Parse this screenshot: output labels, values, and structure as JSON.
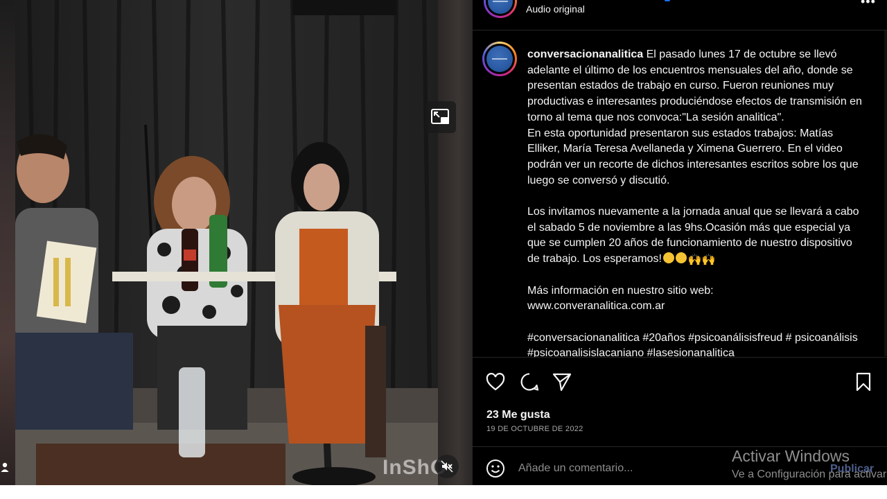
{
  "header": {
    "audio_label": "Audio original",
    "more_icon": "more-dots-icon"
  },
  "post": {
    "username": "conversacionanalitica",
    "caption_lines": [
      " El pasado lunes 17 de octubre se llevó adelante el último de los encuentros mensuales del año, donde se presentan estados de trabajo en curso. Fueron reuniones muy productivas e interesantes produciéndose efectos de transmisión en torno al tema que nos convoca:\"La sesión analitica\".",
      "En esta oportunidad presentaron sus estados trabajos: Matías Elliker, María Teresa Avellaneda y Ximena Guerrero. En el video podrán ver un recorte de dichos interesantes escritos sobre los que luego se conversó y discutió."
    ],
    "invitation": "Los invitamos nuevamente a la jornada anual que se llevará a cabo el sabado 5 de noviembre a las 9hs.Ocasión más que especial ya que se cumplen 20 años de funcionamiento de nuestro dispositivo de trabajo. Los esperamos!",
    "more_info_label": "Más información en nuestro sitio web:",
    "website": "www.converanalitica.com.ar",
    "hashtags": "#conversacionanalitica #20años #psicoanálisisfreud # psicoanálisis #psicoanalisislacaniano #lasesionanalitica",
    "likes": "23 Me gusta",
    "date": "19 DE OCTUBRE DE 2022"
  },
  "video": {
    "watermark": "InShO",
    "pip_icon": "picture-in-picture-icon",
    "mute_icon": "muted-speaker-icon"
  },
  "actions": {
    "like_icon": "heart-icon",
    "comment_icon": "comment-icon",
    "share_icon": "send-icon",
    "save_icon": "bookmark-icon"
  },
  "comment": {
    "placeholder": "Añade un comentario...",
    "publish_label": "Publicar"
  },
  "windows_watermark": {
    "title": "Activar Windows",
    "subtitle": "Ve a Configuración para activar"
  },
  "colors": {
    "panel_bg": "#000000",
    "text": "#f5f5f5",
    "muted": "#8e8e8e",
    "publish": "#4e5f8c",
    "divider": "#262626"
  }
}
